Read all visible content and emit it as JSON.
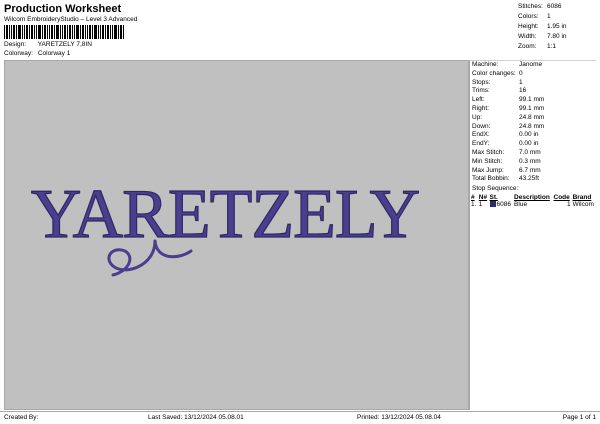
{
  "header": {
    "title": "Production Worksheet",
    "subtitle": "Wilcom EmbroideryStudio – Level 3 Advanced"
  },
  "info": [
    {
      "label": "Design:",
      "value": "YARETZELY 7,8IN"
    },
    {
      "label": "Colorway:",
      "value": "Colorway 1"
    }
  ],
  "stats": [
    {
      "label": "Stitches:",
      "value": "6086"
    },
    {
      "label": "Colors:",
      "value": "1"
    },
    {
      "label": "Height:",
      "value": "1.95 in"
    },
    {
      "label": "Width:",
      "value": "7.80 in"
    },
    {
      "label": "Zoom:",
      "value": "1:1"
    }
  ],
  "design": {
    "text": "YARETZELY",
    "thread_color": "#4a3f8c",
    "background": "#c0c0c0"
  },
  "machine_info": [
    {
      "label": "Machine:",
      "value": "Janome"
    },
    {
      "label": "Color changes:",
      "value": "0"
    },
    {
      "label": "Stops:",
      "value": "1"
    },
    {
      "label": "Trims:",
      "value": "16"
    },
    {
      "label": "Left:",
      "value": "99.1 mm"
    },
    {
      "label": "Right:",
      "value": "99.1 mm"
    },
    {
      "label": "Up:",
      "value": "24.8 mm"
    },
    {
      "label": "Down:",
      "value": "24.8 mm"
    },
    {
      "label": "EndX:",
      "value": "0.00 in"
    },
    {
      "label": "EndY:",
      "value": "0.00 in"
    },
    {
      "label": "Max Stitch:",
      "value": "7.0 mm"
    },
    {
      "label": "Min Stitch:",
      "value": "0.3 mm"
    },
    {
      "label": "Max Jump:",
      "value": "6.7 mm"
    },
    {
      "label": "Total Bobbin:",
      "value": "43.25ft"
    }
  ],
  "stop_sequence": {
    "title": "Stop Sequence:",
    "headers": [
      "#",
      "N#",
      "St.",
      "Description",
      "Code",
      "Brand"
    ],
    "rows": [
      {
        "num": "1.",
        "n": "1",
        "color": "#2a2a6e",
        "st": "6086",
        "desc": "Blue",
        "code": "1",
        "brand": "Wilcom"
      }
    ]
  },
  "footer": {
    "created": "Created By:",
    "last_saved": "Last Saved: 13/12/2024 05.08.01",
    "printed": "Printed: 13/12/2024 05.08.04",
    "page": "Page 1 of 1"
  }
}
